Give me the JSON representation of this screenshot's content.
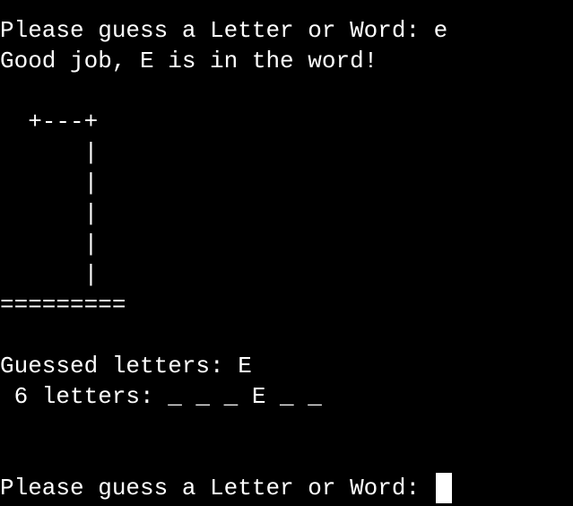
{
  "terminal": {
    "lines": [
      "Please guess a Letter or Word: e",
      "Good job, E is in the word!",
      "",
      "  +---+",
      "      |",
      "      |",
      "      |",
      "      |",
      "      |",
      "=========",
      "",
      "Guessed letters: E",
      " 6 letters: _ _ _ E _ _",
      "",
      "",
      "Please guess a Letter or Word: "
    ],
    "input_value": ""
  }
}
